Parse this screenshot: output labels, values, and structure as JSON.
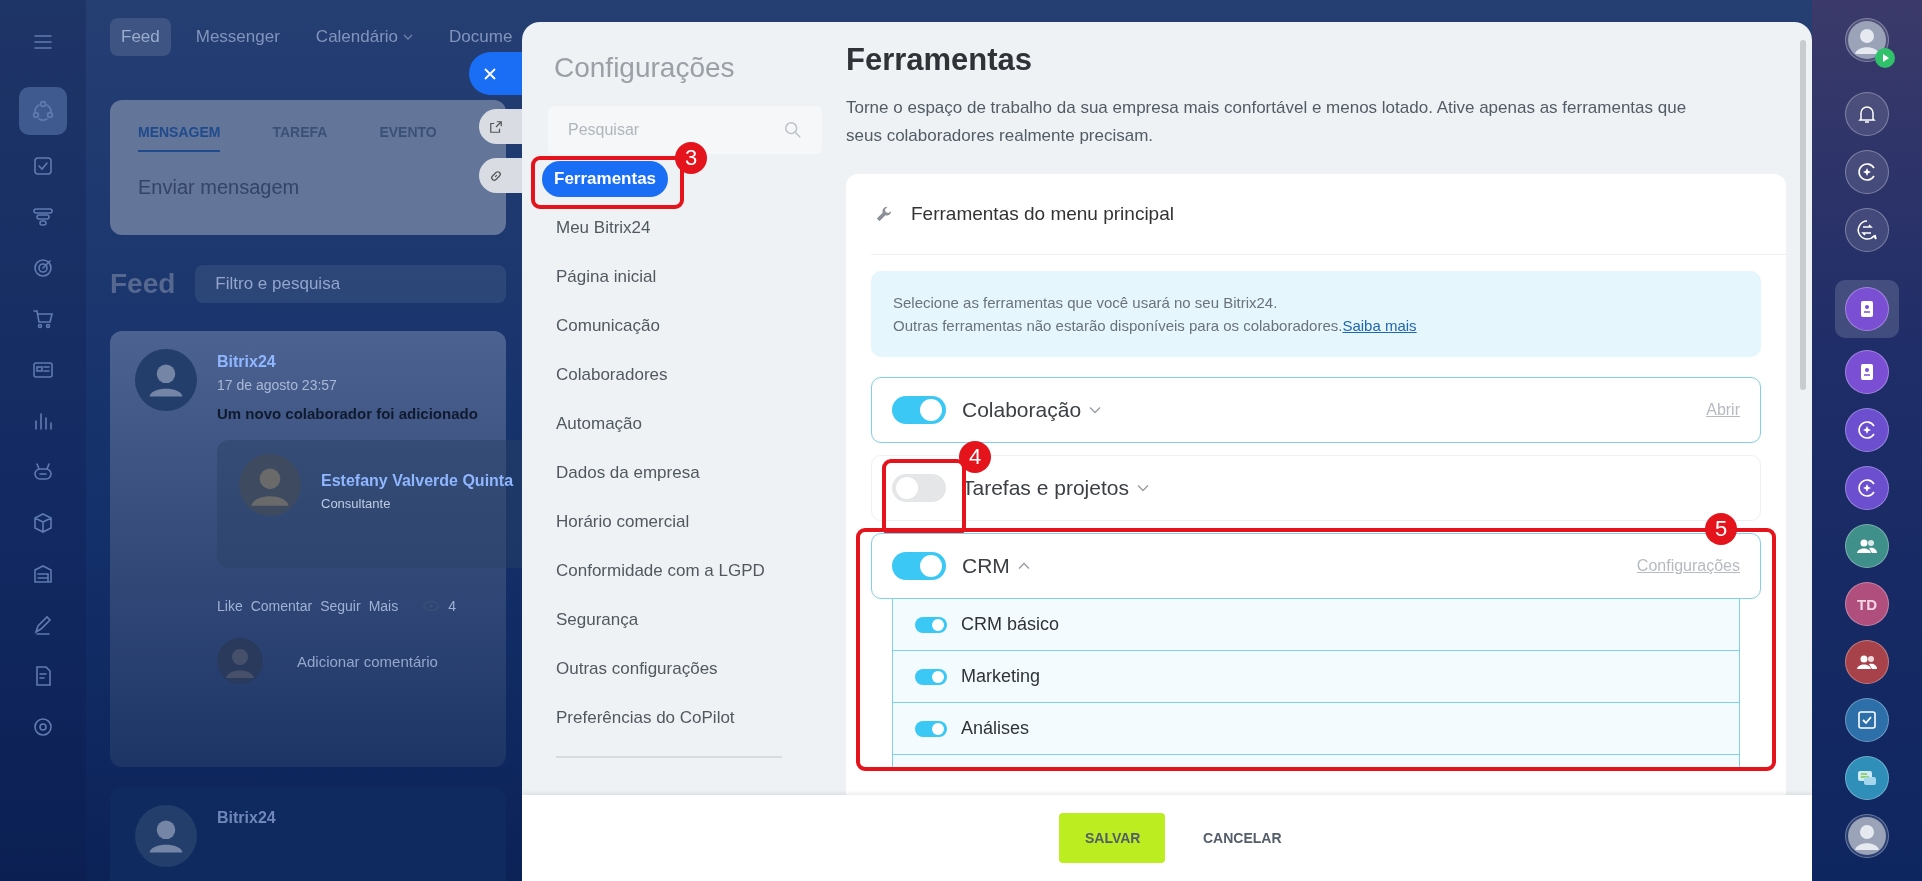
{
  "background_app": {
    "rail": [
      {
        "kind": "menu",
        "selected": false
      },
      {
        "kind": "feed",
        "selected": true
      },
      {
        "kind": "tasks",
        "selected": false
      },
      {
        "kind": "funnel",
        "selected": false
      },
      {
        "kind": "target",
        "selected": false
      },
      {
        "kind": "cart",
        "selected": false
      },
      {
        "kind": "card",
        "selected": false
      },
      {
        "kind": "chart",
        "selected": false
      },
      {
        "kind": "robot",
        "selected": false
      },
      {
        "kind": "box",
        "selected": false
      },
      {
        "kind": "store",
        "selected": false
      },
      {
        "kind": "pen",
        "selected": false
      },
      {
        "kind": "doc",
        "selected": false
      },
      {
        "kind": "gear",
        "selected": false
      }
    ],
    "top_nav": [
      {
        "label": "Feed",
        "selected": true,
        "dropdown": false
      },
      {
        "label": "Messenger",
        "selected": false,
        "dropdown": false
      },
      {
        "label": "Calendário",
        "selected": false,
        "dropdown": true
      },
      {
        "label": "Docume",
        "selected": false,
        "dropdown": false
      }
    ],
    "composer": {
      "tabs": [
        {
          "label": "MENSAGEM",
          "selected": true
        },
        {
          "label": "TAREFA",
          "selected": false
        },
        {
          "label": "EVENTO",
          "selected": false
        }
      ],
      "placeholder": "Enviar mensagem"
    },
    "feed_title": "Feed",
    "filter": {
      "placeholder": "Filtro e pesquisa"
    },
    "posts": [
      {
        "author": "Bitrix24",
        "date": "17 de agosto 23:57",
        "text": "Um novo colaborador foi adicionado",
        "employee": {
          "name": "Estefany Valverde Quinta",
          "position": "Consultante"
        },
        "actions": [
          "Like",
          "Comentar",
          "Seguir",
          "Mais"
        ],
        "views": "4",
        "comment_placeholder": "Adicionar comentário"
      },
      {
        "author": "Bitrix24"
      }
    ]
  },
  "right_bar": [
    {
      "kind": "user",
      "selected": false
    },
    {
      "kind": "bell",
      "selected": false
    },
    {
      "kind": "copilot",
      "selected": false
    },
    {
      "kind": "exchange",
      "selected": false
    },
    {
      "kind": "contact",
      "selected": true,
      "color": "#7a4fd3"
    },
    {
      "kind": "contact",
      "selected": false,
      "color": "#7a4fd3"
    },
    {
      "kind": "copilot",
      "selected": false,
      "color": "#6b4fcf"
    },
    {
      "kind": "copilot",
      "selected": false,
      "color": "#6b4fcf"
    },
    {
      "kind": "group",
      "selected": false,
      "color": "#3f8f8a"
    },
    {
      "kind": "initials",
      "label": "TD",
      "selected": false,
      "color": "#b04f7e"
    },
    {
      "kind": "group",
      "selected": false,
      "color": "#a8424a"
    },
    {
      "kind": "check",
      "selected": false,
      "color": "#2d6fa8"
    },
    {
      "kind": "chat",
      "selected": false,
      "color": "#2f8fb8"
    },
    {
      "kind": "user",
      "selected": false
    }
  ],
  "settings": {
    "title": "Configurações",
    "search": {
      "placeholder": "Pesquisar"
    },
    "nav": [
      {
        "label": "Ferramentas",
        "selected": true,
        "callout": "3"
      },
      {
        "label": "Meu Bitrix24",
        "selected": false
      },
      {
        "label": "Página inicial",
        "selected": false
      },
      {
        "label": "Comunicação",
        "selected": false
      },
      {
        "label": "Colaboradores",
        "selected": false
      },
      {
        "label": "Automação",
        "selected": false
      },
      {
        "label": "Dados da empresa",
        "selected": false
      },
      {
        "label": "Horário comercial",
        "selected": false
      },
      {
        "label": "Conformidade com a LGPD",
        "selected": false
      },
      {
        "label": "Segurança",
        "selected": false
      },
      {
        "label": "Outras configurações",
        "selected": false
      },
      {
        "label": "Preferências do CoPilot",
        "selected": false
      }
    ]
  },
  "content": {
    "title": "Ferramentas",
    "description": "Torne o espaço de trabalho da sua empresa mais confortável e menos lotado. Ative apenas as ferramentas que seus colaboradores realmente precisam.",
    "section": {
      "title": "Ferramentas do menu principal",
      "info": {
        "lines": [
          "Selecione as ferramentas que você usará no seu Bitrix24.",
          "Outras ferramentas não estarão disponíveis para os colaboradores."
        ],
        "link": "Saiba mais"
      },
      "tools": [
        {
          "name": "Colaboração",
          "on": true,
          "expanded": false,
          "action": "Abrir"
        },
        {
          "name": "Tarefas e projetos",
          "on": false,
          "expanded": false,
          "toggle_callout": "4"
        },
        {
          "name": "CRM",
          "on": true,
          "expanded": true,
          "action": "Configurações",
          "callout": "5",
          "children": [
            {
              "name": "CRM básico",
              "on": true
            },
            {
              "name": "Marketing",
              "on": true
            },
            {
              "name": "Análises",
              "on": true
            }
          ]
        }
      ]
    }
  },
  "footer": {
    "buttons": [
      {
        "label": "SALVAR",
        "kind": "primary"
      },
      {
        "label": "CANCELAR",
        "kind": "plain"
      }
    ]
  }
}
